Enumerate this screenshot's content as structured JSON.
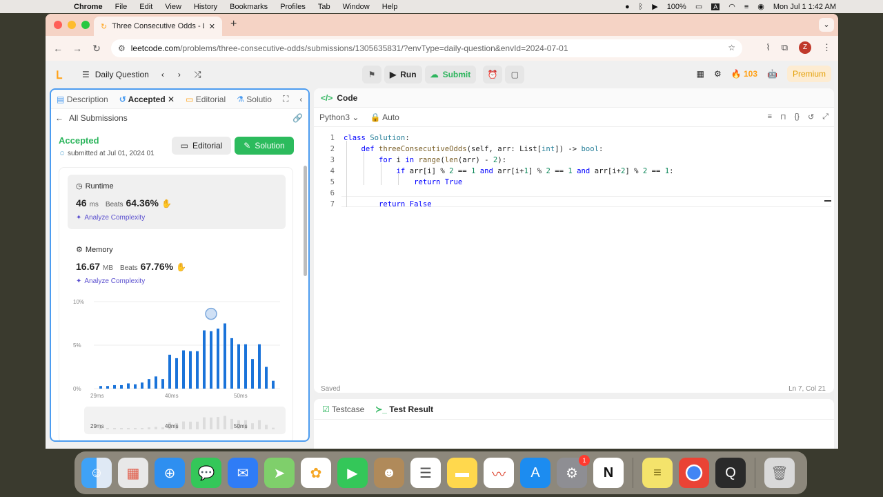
{
  "menubar": {
    "app": "Chrome",
    "items": [
      "File",
      "Edit",
      "View",
      "History",
      "Bookmarks",
      "Profiles",
      "Tab",
      "Window",
      "Help"
    ],
    "battery": "100%",
    "input": "A",
    "clock": "Mon Jul 1  1:42 AM"
  },
  "browser": {
    "tab_title": "Three Consecutive Odds - Le",
    "url_host": "leetcode.com",
    "url_path": "/problems/three-consecutive-odds/submissions/1305635831/?envType=daily-question&envId=2024-07-01",
    "profile_initial": "Z"
  },
  "lc": {
    "daily_question": "Daily Question",
    "run": "Run",
    "submit": "Submit",
    "streak": "103",
    "premium": "Premium"
  },
  "left": {
    "tabs": [
      "Description",
      "Accepted",
      "Editorial",
      "Solutio"
    ],
    "all_submissions": "All Submissions",
    "status": "Accepted",
    "submitted": "submitted at Jul 01, 2024 01",
    "editorial_btn": "Editorial",
    "solution_btn": "Solution",
    "runtime": {
      "title": "Runtime",
      "value": "46",
      "unit": "ms",
      "beats_label": "Beats",
      "beats": "64.36%",
      "analyze": "Analyze Complexity"
    },
    "memory": {
      "title": "Memory",
      "value": "16.67",
      "unit": "MB",
      "beats_label": "Beats",
      "beats": "67.76%",
      "analyze": "Analyze Complexity"
    }
  },
  "chart_data": {
    "type": "bar",
    "yticks": [
      "10%",
      "5%",
      "0%"
    ],
    "xticks": [
      "29ms",
      "40ms",
      "50ms"
    ],
    "ylim": [
      0,
      10
    ],
    "values": [
      0.3,
      0.3,
      0.4,
      0.4,
      0.6,
      0.5,
      0.7,
      1.1,
      1.4,
      1.1,
      3.9,
      3.5,
      4.4,
      4.3,
      4.3,
      6.7,
      6.6,
      6.9,
      7.5,
      5.8,
      5.1,
      5.1,
      3.4,
      5.1,
      2.5,
      0.9
    ],
    "highlight_index": 16,
    "mini_xticks": [
      "29ms",
      "40ms",
      "50ms"
    ]
  },
  "code": {
    "tab": "Code",
    "language": "Python3",
    "mode": "Auto",
    "line_numbers": [
      "1",
      "2",
      "3",
      "4",
      "5",
      "6",
      "7"
    ],
    "saved": "Saved",
    "cursor": "Ln 7, Col 21"
  },
  "test": {
    "tabs": [
      "Testcase",
      "Test Result"
    ]
  },
  "dock": {
    "apps": [
      "finder-icon",
      "launchpad-icon",
      "safari-icon",
      "messages-icon",
      "mail-icon",
      "maps-icon",
      "photos-icon",
      "facetime-icon",
      "contacts-icon",
      "reminders-icon",
      "notes-icon",
      "freeform-icon",
      "app-store-icon",
      "system-settings-icon",
      "notion-icon",
      "stickies-icon",
      "chrome-icon",
      "quicktime-icon",
      "trash-icon"
    ],
    "settings_badge": "1"
  }
}
